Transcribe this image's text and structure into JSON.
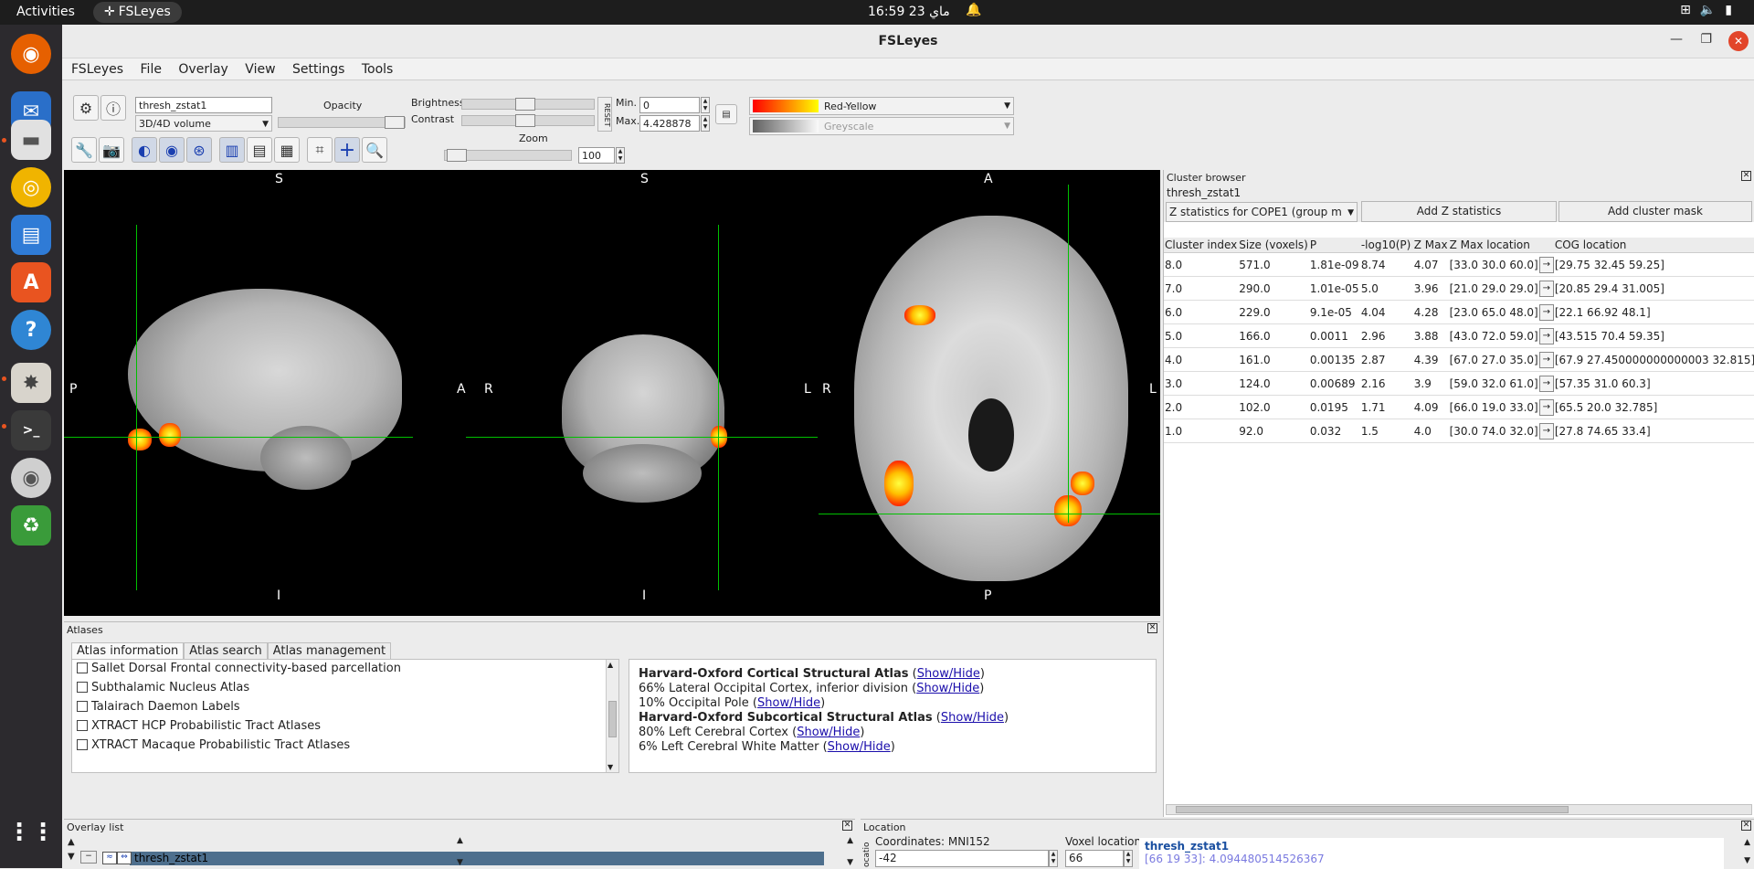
{
  "topbar": {
    "activities": "Activities",
    "app_name": "FSLeyes",
    "clock": "16:59  ماي 23"
  },
  "window": {
    "title": "FSLeyes"
  },
  "menu": {
    "items": [
      "FSLeyes",
      "File",
      "Overlay",
      "View",
      "Settings",
      "Tools"
    ]
  },
  "overlay_toolbar": {
    "name_value": "thresh_zstat1",
    "type_value": "3D/4D volume",
    "opacity_label": "Opacity",
    "brightness_label": "Brightness",
    "contrast_label": "Contrast",
    "reset_label": "RESET",
    "min_label": "Min.",
    "max_label": "Max.",
    "min_value": "0",
    "max_value": "4.428878",
    "colormap": "Red-Yellow",
    "neg_colormap": "Greyscale"
  },
  "ortho_toolbar": {
    "zoom_label": "Zoom",
    "zoom_value": "100"
  },
  "views": {
    "sagittal": {
      "top": "S",
      "bottom": "I",
      "left": "P",
      "right": "A"
    },
    "coronal": {
      "top": "S",
      "bottom": "I",
      "left": "R",
      "right": "L"
    },
    "axial": {
      "top": "A",
      "bottom": "P",
      "left": "R",
      "right": "L"
    }
  },
  "cluster_browser": {
    "title": "Cluster browser",
    "overlay_name": "thresh_zstat1",
    "contrast_select": "Z statistics for COPE1 (group m",
    "add_z_button": "Add Z statistics",
    "add_mask_button": "Add cluster mask",
    "columns": [
      "Cluster index",
      "Size (voxels)",
      "P",
      "-log10(P)",
      "Z Max",
      "Z Max location",
      "COG location"
    ],
    "rows": [
      [
        "8.0",
        "571.0",
        "1.81e-09",
        "8.74",
        "4.07",
        "[33.0 30.0 60.0]",
        "[29.75 32.45 59.25]"
      ],
      [
        "7.0",
        "290.0",
        "1.01e-05",
        "5.0",
        "3.96",
        "[21.0 29.0 29.0]",
        "[20.85 29.4 31.005]"
      ],
      [
        "6.0",
        "229.0",
        "9.1e-05",
        "4.04",
        "4.28",
        "[23.0 65.0 48.0]",
        "[22.1 66.92 48.1]"
      ],
      [
        "5.0",
        "166.0",
        "0.0011",
        "2.96",
        "3.88",
        "[43.0 72.0 59.0]",
        "[43.515 70.4 59.35]"
      ],
      [
        "4.0",
        "161.0",
        "0.00135",
        "2.87",
        "4.39",
        "[67.0 27.0 35.0]",
        "[67.9 27.450000000000003 32.815]"
      ],
      [
        "3.0",
        "124.0",
        "0.00689",
        "2.16",
        "3.9",
        "[59.0 32.0 61.0]",
        "[57.35 31.0 60.3]"
      ],
      [
        "2.0",
        "102.0",
        "0.0195",
        "1.71",
        "4.09",
        "[66.0 19.0 33.0]",
        "[65.5 20.0 32.785]"
      ],
      [
        "1.0",
        "92.0",
        "0.032",
        "1.5",
        "4.0",
        "[30.0 74.0 32.0]",
        "[27.8 74.65 33.4]"
      ]
    ]
  },
  "atlases": {
    "title": "Atlases",
    "tabs": [
      "Atlas information",
      "Atlas search",
      "Atlas management"
    ],
    "list": [
      "Sallet Dorsal Frontal connectivity-based parcellation",
      "Subthalamic Nucleus Atlas",
      "Talairach Daemon Labels",
      "XTRACT HCP Probabilistic Tract Atlases",
      "XTRACT Macaque Probabilistic Tract Atlases"
    ],
    "info": [
      {
        "text": "Harvard-Oxford Cortical Structural Atlas",
        "bold": true
      },
      {
        "text": "66% Lateral Occipital Cortex, inferior division",
        "bold": false
      },
      {
        "text": "10% Occipital Pole",
        "bold": false
      },
      {
        "text": "Harvard-Oxford Subcortical Structural Atlas",
        "bold": true
      },
      {
        "text": "80% Left Cerebral Cortex",
        "bold": false
      },
      {
        "text": "6% Left Cerebral White Matter",
        "bold": false
      }
    ],
    "showhide": "Show/Hide"
  },
  "overlay_list": {
    "title": "Overlay list",
    "item": "thresh_zstat1"
  },
  "location": {
    "title": "Location",
    "coords_label": "Coordinates: MNI152",
    "coord_value": "-42",
    "voxel_label": "Voxel location",
    "voxel_value": "66",
    "side_label": "ocatio",
    "info_name": "thresh_zstat1",
    "info_value": "[66 19 33]: 4.094480514526367"
  }
}
